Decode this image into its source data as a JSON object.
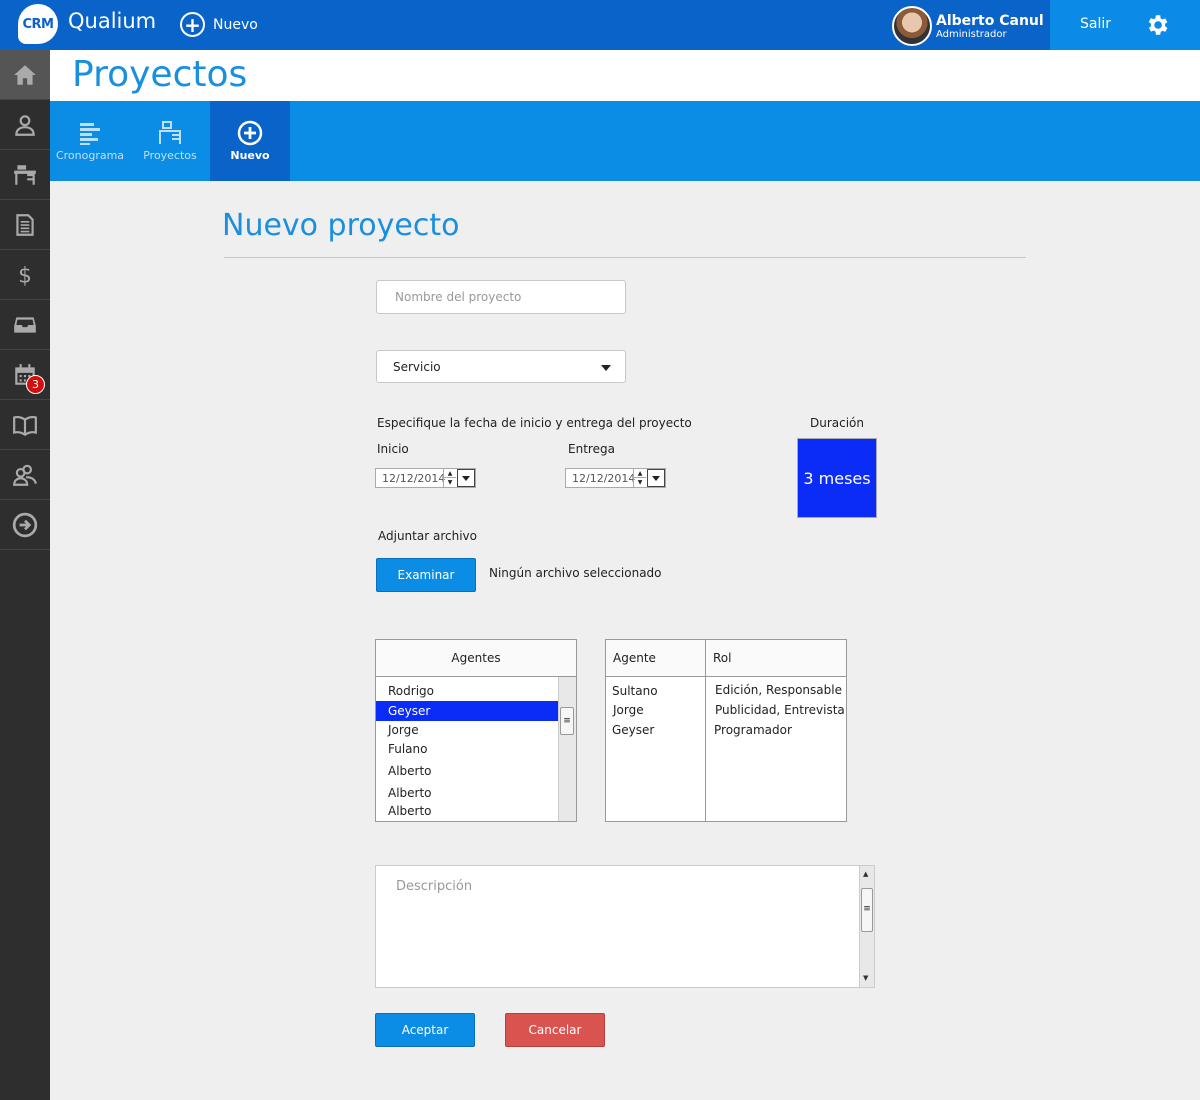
{
  "app": {
    "logo": "CRM",
    "name": "Qualium",
    "new_label": "Nuevo"
  },
  "user": {
    "name": "Alberto Canul",
    "role": "Administrador"
  },
  "top_right": {
    "logout_label": "Salir"
  },
  "sidebar": {
    "items": [
      {
        "name": "home"
      },
      {
        "name": "contacts"
      },
      {
        "name": "projects"
      },
      {
        "name": "documents"
      },
      {
        "name": "finance"
      },
      {
        "name": "inbox"
      },
      {
        "name": "calendar",
        "badge": "3"
      },
      {
        "name": "catalog"
      },
      {
        "name": "team"
      },
      {
        "name": "logout"
      }
    ]
  },
  "page": {
    "title": "Proyectos"
  },
  "subnav": {
    "items": [
      {
        "label": "Cronograma"
      },
      {
        "label": "Proyectos"
      },
      {
        "label": "Nuevo"
      }
    ]
  },
  "form": {
    "title": "Nuevo proyecto",
    "name_placeholder": "Nombre del proyecto",
    "service_value": "Servicio",
    "dates_label": "Especifique la fecha de inicio y entrega del proyecto",
    "start_label": "Inicio",
    "start_value": "12/12/2014",
    "end_label": "Entrega",
    "end_value": "12/12/2014",
    "duration_label": "Duración",
    "duration_value": "3 meses",
    "attach_label": "Adjuntar archivo",
    "browse_label": "Examinar",
    "no_file_label": "Ningún archivo seleccionado",
    "agents_header": "Agentes",
    "agents": [
      "Rodrigo",
      "Geyser",
      "Jorge",
      "Fulano",
      "Alberto",
      "Alberto",
      "Alberto"
    ],
    "selected_agent": "Geyser",
    "assigned_headers": {
      "agent": "Agente",
      "role": "Rol"
    },
    "assigned": [
      {
        "agent": "Sultano",
        "role": "Edición, Responsable"
      },
      {
        "agent": "Jorge",
        "role": " Publicidad, Entrevista"
      },
      {
        "agent": "Geyser",
        "role": "Programador"
      }
    ],
    "description_placeholder": "Descripción",
    "accept_label": "Aceptar",
    "cancel_label": "Cancelar"
  },
  "colors": {
    "topbar": "#0a63c9",
    "accent": "#0b8de6",
    "title": "#1a8fe0",
    "duration_bg": "#0a2cf6",
    "cancel": "#d9534f",
    "sidebar": "#2e2e2e"
  }
}
